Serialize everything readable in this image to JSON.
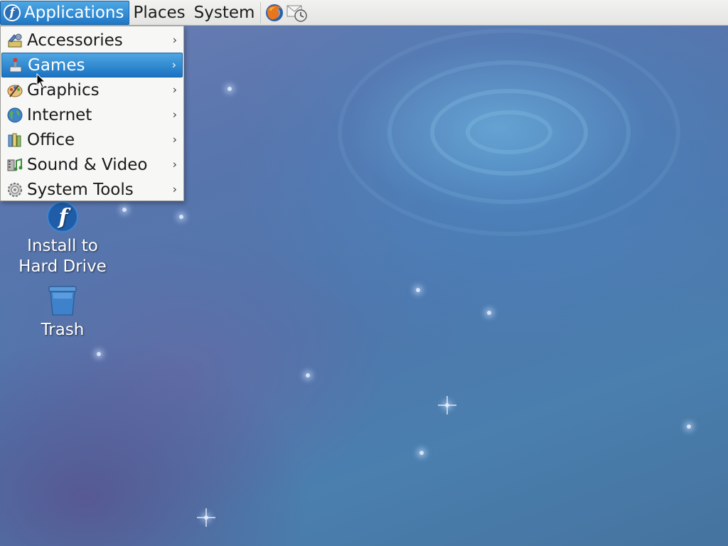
{
  "top_panel": {
    "applications_label": "Applications",
    "places_label": "Places",
    "system_label": "System",
    "launchers": [
      {
        "name": "firefox-icon"
      },
      {
        "name": "mail-clock-icon"
      }
    ]
  },
  "apps_menu": {
    "selected_index": 1,
    "items": [
      {
        "label": "Accessories",
        "icon": "accessories-icon"
      },
      {
        "label": "Games",
        "icon": "games-icon"
      },
      {
        "label": "Graphics",
        "icon": "graphics-icon"
      },
      {
        "label": "Internet",
        "icon": "internet-icon"
      },
      {
        "label": "Office",
        "icon": "office-icon"
      },
      {
        "label": "Sound & Video",
        "icon": "sound-video-icon"
      },
      {
        "label": "System Tools",
        "icon": "system-tools-icon"
      }
    ],
    "submenu_arrow": "›"
  },
  "desktop": {
    "icons": [
      {
        "label_line1": "Install to",
        "label_line2": "Hard Drive",
        "icon": "fedora-install-icon"
      },
      {
        "label": "Trash",
        "icon": "trash-icon"
      }
    ]
  },
  "colors": {
    "selection": "#2a87d4",
    "panel": "#ededeb",
    "desktop": "#4f78ad"
  }
}
